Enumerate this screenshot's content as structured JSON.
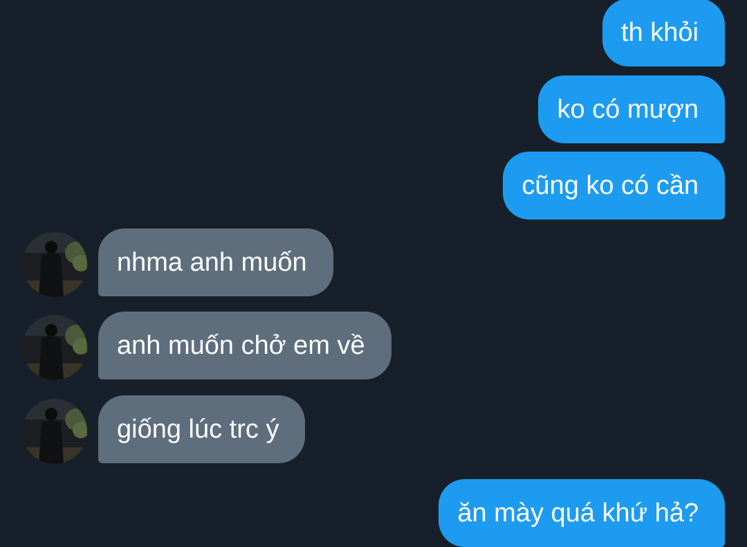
{
  "conversation": {
    "messages": [
      {
        "direction": "sent",
        "text": "th khỏi"
      },
      {
        "direction": "sent",
        "text": "ko có mượn"
      },
      {
        "direction": "sent",
        "text": "cũng ko có cần"
      },
      {
        "direction": "received",
        "text": "nhma anh muốn"
      },
      {
        "direction": "received",
        "text": "anh muốn chở em về"
      },
      {
        "direction": "received",
        "text": "giống lúc trc ý"
      },
      {
        "direction": "sent",
        "text": "ăn mày quá khứ hả?"
      }
    ]
  },
  "colors": {
    "background": "#17202a",
    "sent_bubble": "#1d9bf0",
    "received_bubble": "#5e6e7d",
    "text": "#ffffff"
  },
  "icons": {
    "avatar": "contact-photo-avatar"
  }
}
